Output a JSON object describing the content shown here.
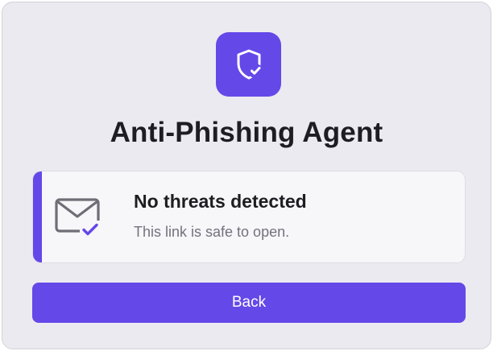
{
  "app": {
    "title": "Anti-Phishing Agent",
    "logo_icon": "shield-check-icon"
  },
  "status": {
    "heading": "No threats detected",
    "message": "This link is safe to open.",
    "icon": "mail-check-icon"
  },
  "actions": {
    "back_label": "Back"
  },
  "colors": {
    "accent": "#6448e8",
    "background": "#eceaf1",
    "panel": "#f7f6f9",
    "text_primary": "#1d1d22",
    "text_secondary": "#74727c"
  }
}
